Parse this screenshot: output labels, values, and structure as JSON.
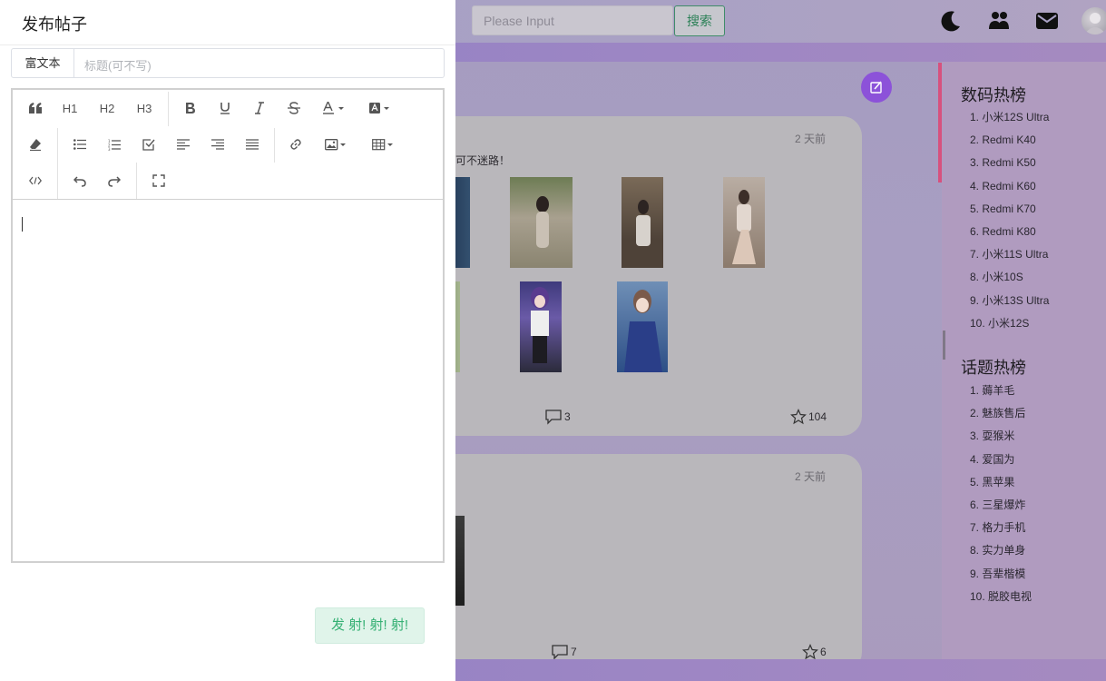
{
  "header": {
    "search_placeholder": "Please Input",
    "search_button": "搜索",
    "icons": [
      "moon-icon",
      "users-icon",
      "mail-icon",
      "avatar"
    ]
  },
  "feed": {
    "posts": [
      {
        "time": "2 天前",
        "text_fragment": "可不迷路！",
        "comments": "3",
        "stars": "104"
      },
      {
        "time": "2 天前",
        "comments": "7",
        "stars": "6"
      }
    ]
  },
  "ranks": {
    "digital_title": "数码热榜",
    "digital_items": [
      "1. 小米12S Ultra",
      "2. Redmi K40",
      "3. Redmi K50",
      "4. Redmi K60",
      "5. Redmi K70",
      "6. Redmi K80",
      "7. 小米11S Ultra",
      "8. 小米10S",
      "9. 小米13S Ultra",
      "10. 小米12S"
    ],
    "topic_title": "话题热榜",
    "topic_items": [
      "1. 薅羊毛",
      "2. 魅族售后",
      "3. 耍猴米",
      "4. 爱国为",
      "5. 黑苹果",
      "6. 三星爆炸",
      "7. 格力手机",
      "8. 实力单身",
      "9. 吾辈楷模",
      "10. 脱胶电视"
    ]
  },
  "drawer": {
    "title": "发布帖子",
    "mode_button": "富文本",
    "title_placeholder": "标题(可不写)",
    "toolbar": {
      "h1": "H1",
      "h2": "H2",
      "h3": "H3"
    },
    "submit_label": "发 射! 射! 射!"
  },
  "colors": {
    "accent_purple": "#8c52d9",
    "submit_green": "#35b074",
    "pink_accent": "#d7517e"
  }
}
